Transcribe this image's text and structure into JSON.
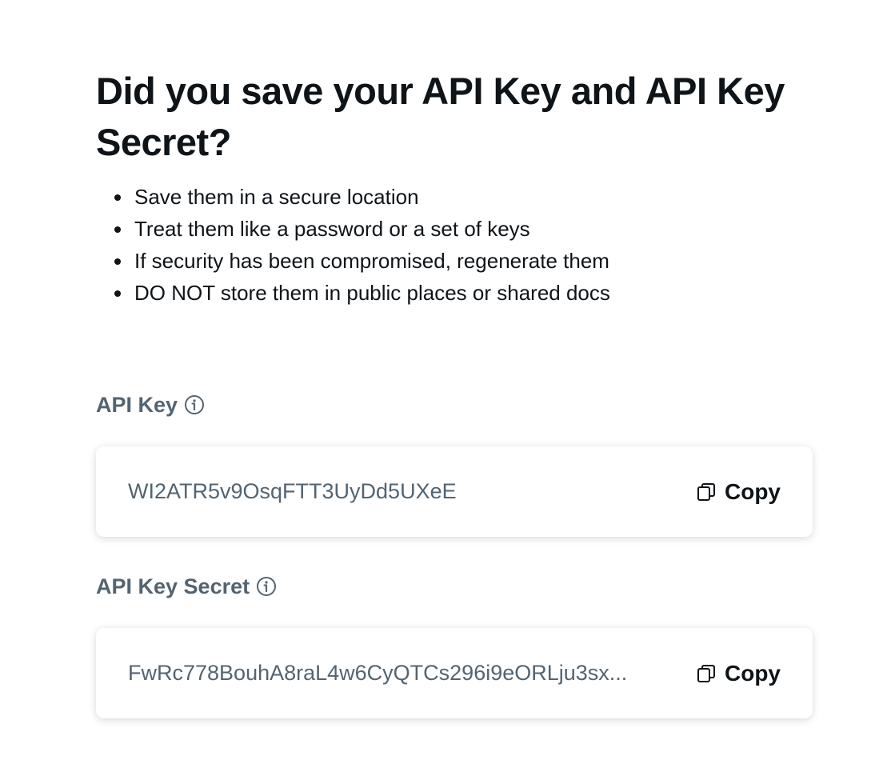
{
  "heading": {
    "title": "Did you save your API Key and API Key Secret?"
  },
  "tips": [
    "Save them in a secure location",
    "Treat them like a password or a set of keys",
    "If security has been compromised, regenerate them",
    "DO NOT store them in public places or shared docs"
  ],
  "api_key": {
    "label": "API Key",
    "info_icon": "info-icon",
    "value": "WI2ATR5v9OsqFTT3UyDd5UXeE",
    "copy_label": "Copy",
    "copy_icon": "copy-icon"
  },
  "api_key_secret": {
    "label": "API Key Secret",
    "info_icon": "info-icon",
    "value": "FwRc778BouhA8raL4w6CyQTCs296i9eORLju3sx...",
    "copy_label": "Copy",
    "copy_icon": "copy-icon"
  },
  "colors": {
    "text_primary": "#0f1419",
    "text_secondary": "#536471",
    "background": "#ffffff"
  }
}
